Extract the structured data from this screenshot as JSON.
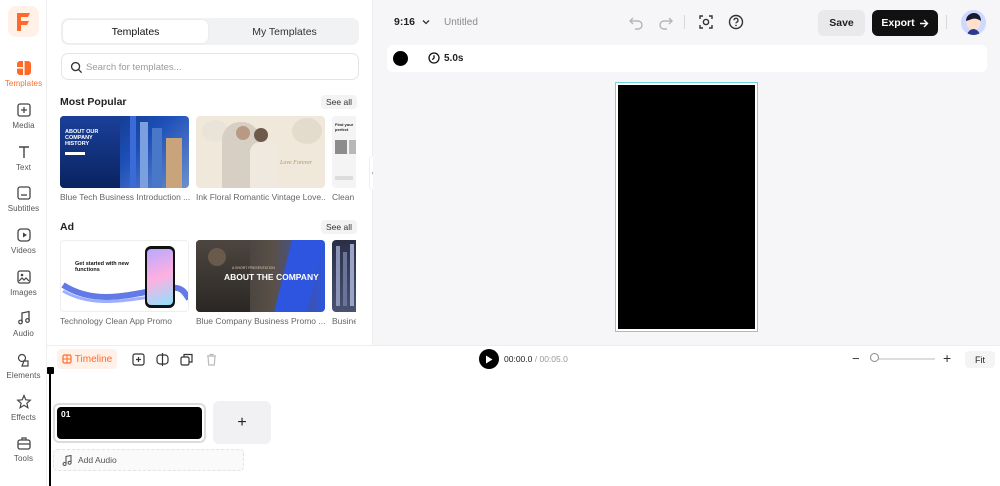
{
  "app": {
    "logo_letter": "F",
    "accent": "#ff6a2b"
  },
  "rail": {
    "items": [
      {
        "label": "Templates",
        "icon": "templates-icon"
      },
      {
        "label": "Media",
        "icon": "media-icon"
      },
      {
        "label": "Text",
        "icon": "text-icon"
      },
      {
        "label": "Subtitles",
        "icon": "subtitles-icon"
      },
      {
        "label": "Videos",
        "icon": "videos-icon"
      },
      {
        "label": "Images",
        "icon": "images-icon"
      },
      {
        "label": "Audio",
        "icon": "audio-icon"
      },
      {
        "label": "Elements",
        "icon": "elements-icon"
      },
      {
        "label": "Effects",
        "icon": "effects-icon"
      },
      {
        "label": "Tools",
        "icon": "tools-icon"
      }
    ]
  },
  "panel": {
    "tabs": [
      "Templates",
      "My Templates"
    ],
    "search_placeholder": "Search for templates...",
    "sections": [
      {
        "title": "Most Popular",
        "see_all": "See all",
        "items": [
          {
            "caption": "Blue Tech Business Introduction ...",
            "thumb_text": "ABOUT OUR COMPANY HISTORY"
          },
          {
            "caption": "Ink Floral Romantic Vintage Love...",
            "thumb_text": "Love Forever"
          },
          {
            "caption": "Clean I",
            "thumb_text": "Find your perfect"
          }
        ]
      },
      {
        "title": "Ad",
        "see_all": "See all",
        "items": [
          {
            "caption": "Technology Clean App Promo",
            "thumb_text": "Get started with new functions"
          },
          {
            "caption": "Blue Company Business Promo ...",
            "thumb_text": "ABOUT THE COMPANY",
            "thumb_small": "A SHORT PRESENTATION"
          },
          {
            "caption": "Busine",
            "thumb_text": ""
          }
        ]
      }
    ]
  },
  "topbar": {
    "ratio": "9:16",
    "title": "Untitled",
    "save": "Save",
    "export": "Export"
  },
  "canvas": {
    "duration": "5.0s",
    "background_color": "#000000"
  },
  "timeline": {
    "tab": "Timeline",
    "current_time": "00:00.0",
    "separator": " / ",
    "total_time": "00:05.0",
    "fit": "Fit",
    "clip_number": "01",
    "add_clip": "+",
    "add_audio": "Add Audio",
    "zoom_level": 0
  }
}
